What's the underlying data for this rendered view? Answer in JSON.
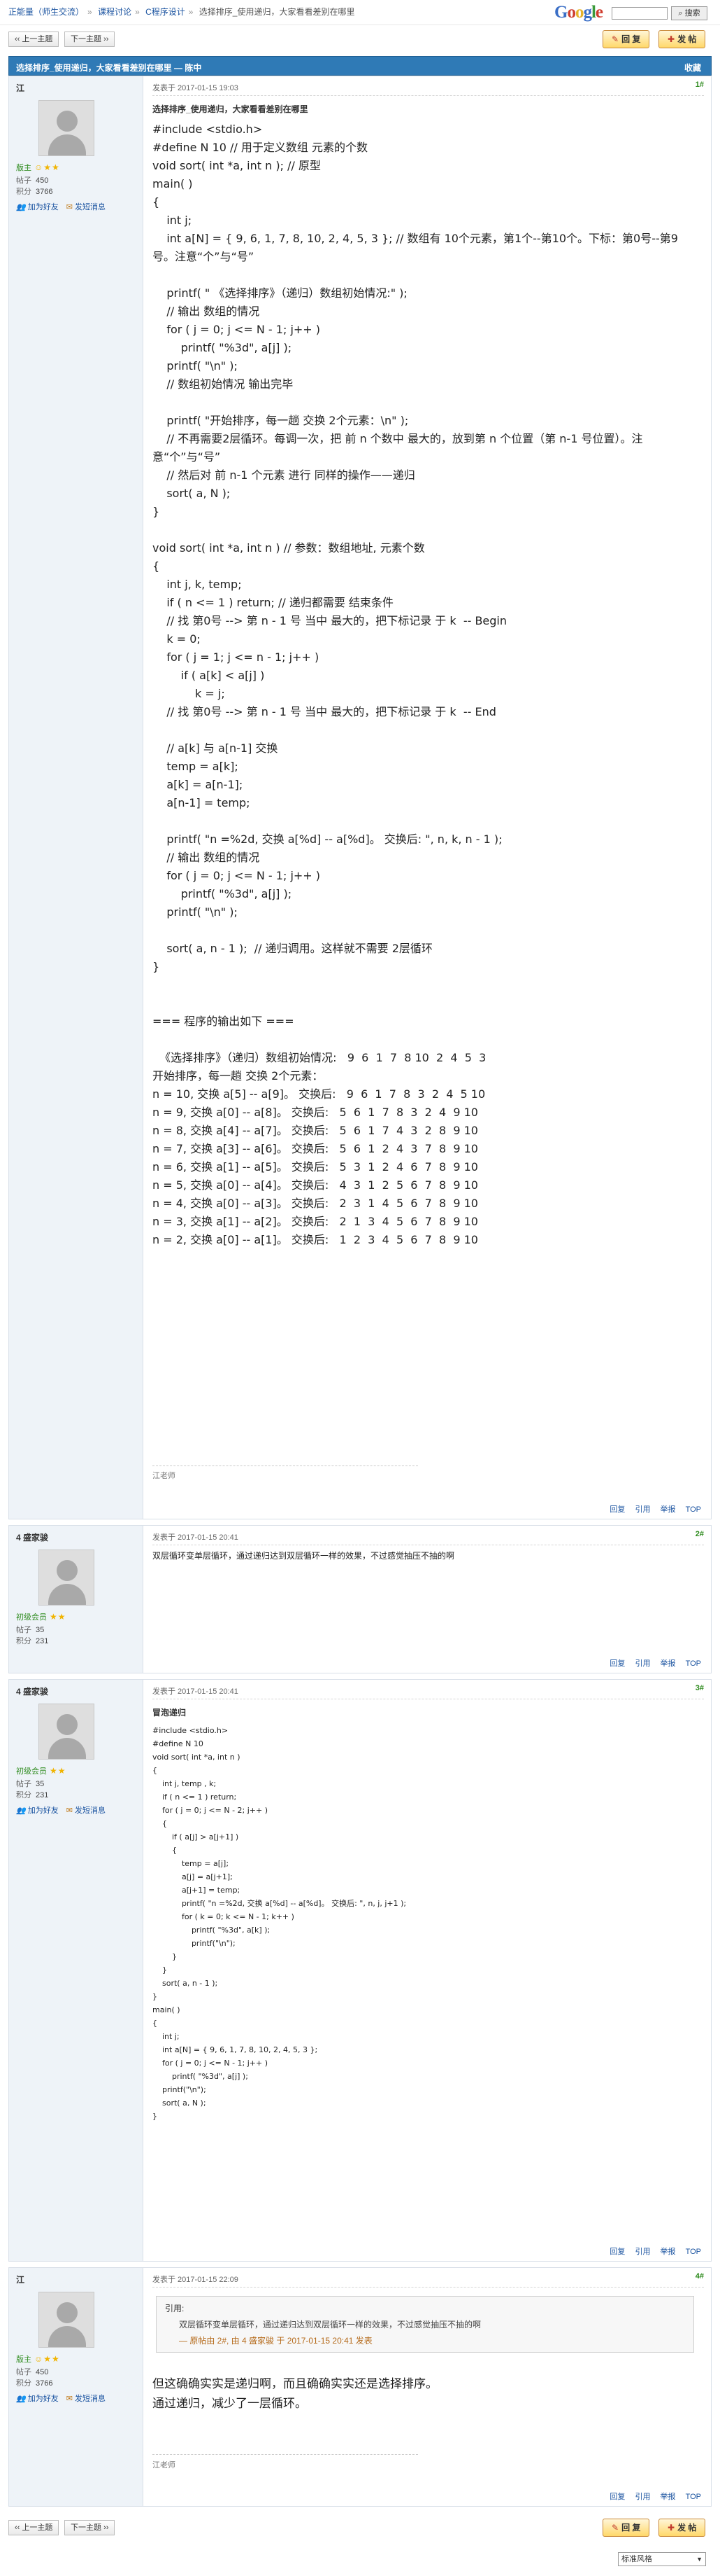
{
  "breadcrumb": [
    "正能量（师生交流）",
    "课程讨论",
    "C程序设计",
    "选择排序_使用递归，大家看看差别在哪里"
  ],
  "google": {
    "search_button": "搜索"
  },
  "pager": {
    "prev": "上一主题",
    "next": "下一主题",
    "reply": "回 复",
    "post": "发 帖"
  },
  "thread": {
    "title": "选择排序_使用递归，大家看看差别在哪里 — 陈中",
    "favorite": "收藏"
  },
  "labels": {
    "posts": "帖子",
    "points": "积分",
    "add_friend": "加为好友",
    "send_message": "发短消息",
    "reply": "回复",
    "quote": "引用",
    "report": "举报",
    "top": "TOP"
  },
  "posts": [
    {
      "user": "江",
      "level": "版主",
      "posts_count": "450",
      "points": "3766",
      "time": "发表于 2017-01-15 19:03",
      "floor": "1#",
      "title": "选择排序_使用递归，大家看看差别在哪里",
      "lines": [
        "#include <stdio.h>",
        "#define N 10 // 用于定义数组 元素的个数",
        "void sort( int *a, int n ); // 原型",
        "main( )",
        "{",
        "    int j;",
        "    int a[N] = { 9, 6, 1, 7, 8, 10, 2, 4, 5, 3 }; // 数组有 10个元素，第1个--第10个。下标：第0号--第9号。注意“个”与“号”",
        "",
        "    printf( \" 《选择排序》（递归）数组初始情况:\" );",
        "    // 输出 数组的情况",
        "    for ( j = 0; j <= N - 1; j++ )",
        "        printf( \"%3d\", a[j] );",
        "    printf( \"\\n\" );",
        "    // 数组初始情况 输出完毕",
        "",
        "    printf( \"开始排序，每一趟 交换 2个元素：\\n\" );",
        "    // 不再需要2层循环。每调一次，把 前 n 个数中 最大的，放到第 n 个位置（第 n-1 号位置）。注意“个”与“号”",
        "    // 然后对 前 n-1 个元素 进行 同样的操作——递归",
        "    sort( a, N );",
        "}",
        "",
        "void sort( int *a, int n ) // 参数：数组地址, 元素个数",
        "{",
        "    int j, k, temp;",
        "    if ( n <= 1 ) return; // 递归都需要 结束条件",
        "    // 找 第0号 --> 第 n - 1 号 当中 最大的，把下标记录 于 k  -- Begin",
        "    k = 0;",
        "    for ( j = 1; j <= n - 1; j++ )",
        "        if ( a[k] < a[j] )",
        "            k = j;",
        "    // 找 第0号 --> 第 n - 1 号 当中 最大的，把下标记录 于 k  -- End",
        "",
        "    // a[k] 与 a[n-1] 交换",
        "    temp = a[k];",
        "    a[k] = a[n-1];",
        "    a[n-1] = temp;",
        "",
        "    printf( \"n =%2d, 交换 a[%d] -- a[%d]。 交换后: \", n, k, n - 1 );",
        "    // 输出 数组的情况",
        "    for ( j = 0; j <= N - 1; j++ )",
        "        printf( \"%3d\", a[j] );",
        "    printf( \"\\n\" );",
        "",
        "    sort( a, n - 1 );  // 递归调用。这样就不需要 2层循环",
        "}",
        "",
        "",
        "=== 程序的输出如下 ===",
        "",
        "  《选择排序》（递归）数组初始情况:   9  6  1  7  8 10  2  4  5  3",
        "开始排序，每一趟 交换 2个元素：",
        "n = 10, 交换 a[5] -- a[9]。 交换后:   9  6  1  7  8  3  2  4  5 10",
        "n = 9, 交换 a[0] -- a[8]。 交换后:   5  6  1  7  8  3  2  4  9 10",
        "n = 8, 交换 a[4] -- a[7]。 交换后:   5  6  1  7  4  3  2  8  9 10",
        "n = 7, 交换 a[3] -- a[6]。 交换后:   5  6  1  2  4  3  7  8  9 10",
        "n = 6, 交换 a[1] -- a[5]。 交换后:   5  3  1  2  4  6  7  8  9 10",
        "n = 5, 交换 a[0] -- a[4]。 交换后:   4  3  1  2  5  6  7  8  9 10",
        "n = 4, 交换 a[0] -- a[3]。 交换后:   2  3  1  4  5  6  7  8  9 10",
        "n = 3, 交换 a[1] -- a[2]。 交换后:   2  1  3  4  5  6  7  8  9 10",
        "n = 2, 交换 a[0] -- a[1]。 交换后:   1  2  3  4  5  6  7  8  9 10"
      ],
      "signature": "江老师"
    },
    {
      "user": "4 盛家骏",
      "level": "初级会员",
      "posts_count": "35",
      "points": "231",
      "time": "发表于 2017-01-15 20:41",
      "floor": "2#",
      "text": "双层循环变单层循环，通过递归达到双层循环一样的效果，不过感觉抽压不抽的啊"
    },
    {
      "user": "4 盛家骏",
      "level": "初级会员",
      "posts_count": "35",
      "points": "231",
      "time": "发表于 2017-01-15 20:41",
      "floor": "3#",
      "title": "冒泡递归",
      "lines": [
        "#include <stdio.h>",
        "#define N 10",
        "void sort( int *a, int n )",
        "{",
        "    int j, temp , k;",
        "    if ( n <= 1 ) return;",
        "    for ( j = 0; j <= N - 2; j++ )",
        "    {",
        "        if ( a[j] > a[j+1] )",
        "        {",
        "            temp = a[j];",
        "            a[j] = a[j+1];",
        "            a[j+1] = temp;",
        "            printf( \"n =%2d, 交换 a[%d] -- a[%d]。 交换后: \", n, j, j+1 );",
        "            for ( k = 0; k <= N - 1; k++ )",
        "                printf( \"%3d\", a[k] );",
        "                printf(\"\\n\");",
        "        }",
        "    }",
        "    sort( a, n - 1 );",
        "}",
        "main( )",
        "{",
        "    int j;",
        "    int a[N] = { 9, 6, 1, 7, 8, 10, 2, 4, 5, 3 };",
        "    for ( j = 0; j <= N - 1; j++ )",
        "        printf( \"%3d\", a[j] );",
        "    printf(\"\\n\");",
        "    sort( a, N );",
        "}"
      ]
    },
    {
      "user": "江",
      "level": "版主",
      "posts_count": "450",
      "points": "3766",
      "time": "发表于 2017-01-15 22:09",
      "floor": "4#",
      "quote": {
        "head": "引用:",
        "text": "双层循环变单层循环，通过递归达到双层循环一样的效果，不过感觉抽压不抽的啊",
        "source": "— 原帖由 2#, 由 4 盛家骏 于 2017-01-15 20:41 发表"
      },
      "lines": [
        "但这确确实实是递归啊，而且确确实实还是选择排序。",
        "通过递归，减少了一层循环。"
      ],
      "signature": "江老师"
    }
  ],
  "footer": {
    "style_select": "标准风格"
  }
}
